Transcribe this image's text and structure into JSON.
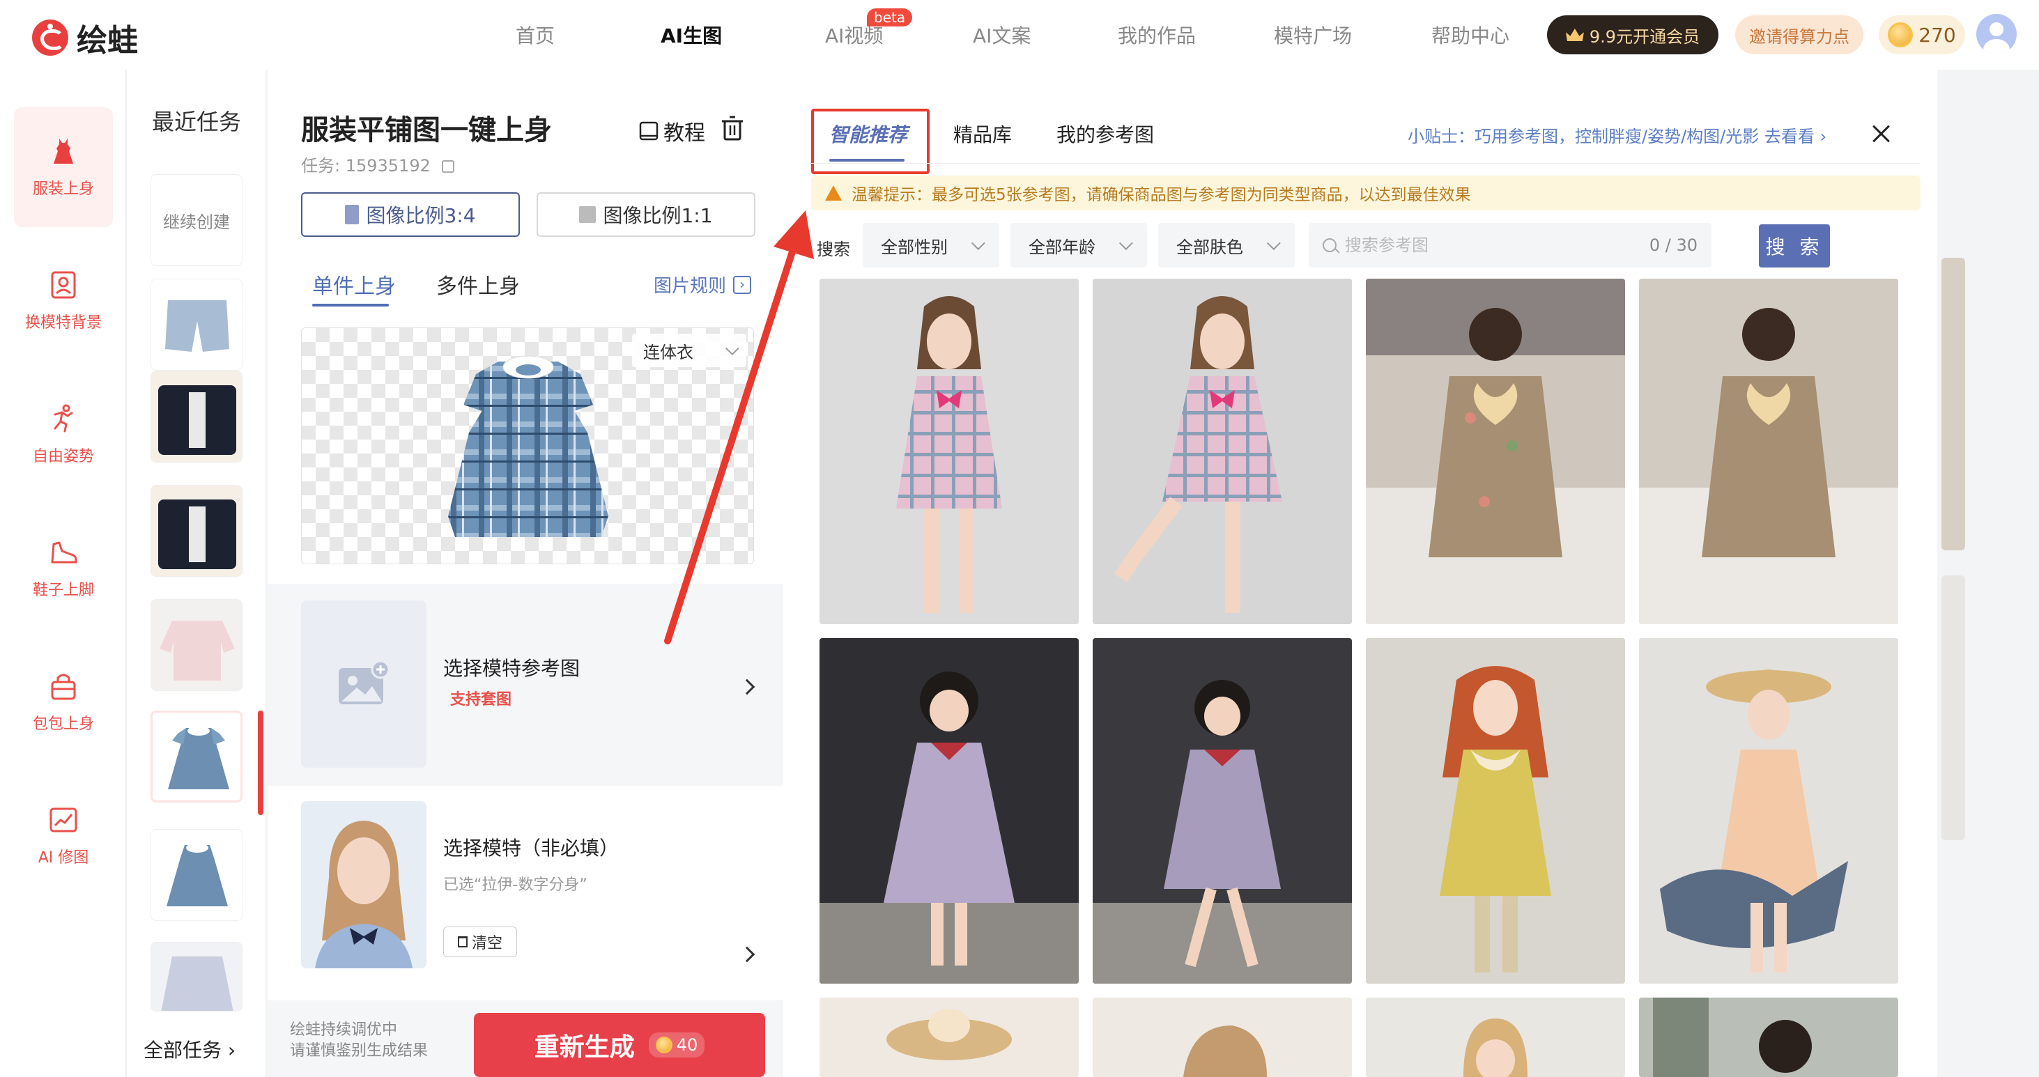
{
  "app": {
    "logo_text": "绘蛙"
  },
  "nav": {
    "items": [
      {
        "label": "首页",
        "active": false
      },
      {
        "label": "AI生图",
        "active": true
      },
      {
        "label": "AI视频",
        "active": false,
        "badge": "beta"
      },
      {
        "label": "AI文案",
        "active": false
      },
      {
        "label": "我的作品",
        "active": false
      },
      {
        "label": "模特广场",
        "active": false
      },
      {
        "label": "帮助中心",
        "active": false
      }
    ],
    "vip_label": "9.9元开通会员",
    "invite_label": "邀请得算力点",
    "coins": "270"
  },
  "sidebar": {
    "items": [
      {
        "label": "服装上身",
        "icon": "dress-icon",
        "active": true
      },
      {
        "label": "换模特背景",
        "icon": "portrait-frame-icon",
        "active": false
      },
      {
        "label": "自由姿势",
        "icon": "running-figure-icon",
        "active": false
      },
      {
        "label": "鞋子上脚",
        "icon": "shoe-icon",
        "active": false
      },
      {
        "label": "包包上身",
        "icon": "bag-icon",
        "active": false
      },
      {
        "label": "AI 修图",
        "icon": "photo-edit-icon",
        "active": false
      }
    ]
  },
  "recent": {
    "title": "最近任务",
    "continue_label": "继续创建",
    "all_tasks_label": "全部任务"
  },
  "work": {
    "title": "服装平铺图一键上身",
    "task_id": "任务: 15935192",
    "tutorial_label": "教程",
    "ratio_options": [
      {
        "label": "图像比例3:4",
        "active": true
      },
      {
        "label": "图像比例1:1",
        "active": false
      }
    ],
    "modes": [
      {
        "label": "单件上身",
        "active": true
      },
      {
        "label": "多件上身",
        "active": false
      }
    ],
    "image_rules_label": "图片规则",
    "category_select": "连体衣",
    "ref_section": {
      "title": "选择模特参考图",
      "subtitle": "支持套图"
    },
    "model_section": {
      "title": "选择模特（非必填）",
      "subtitle": "已选“拉伊-数字分身”",
      "clear_label": "清空"
    },
    "bottom_note_1": "绘蛙持续调优中",
    "bottom_note_2": "请谨慎鉴别生成结果",
    "regen_label": "重新生成",
    "regen_cost": "40"
  },
  "refpanel": {
    "tabs": [
      {
        "label": "智能推荐",
        "active": true
      },
      {
        "label": "精品库",
        "active": false
      },
      {
        "label": "我的参考图",
        "active": false
      }
    ],
    "tip": "小贴士：巧用参考图，控制胖瘦/姿势/构图/光影 去看看",
    "warning": "温馨提示：最多可选5张参考图，请确保商品图与参考图为同类型商品，以达到最佳效果",
    "search_label": "搜索",
    "filters": [
      "全部性别",
      "全部年龄",
      "全部肤色"
    ],
    "search_placeholder": "搜索参考图",
    "search_counter": "0 / 30",
    "search_button": "搜 索"
  },
  "colors": {
    "brand_red": "#e8403f",
    "accent_blue": "#5b6fb5",
    "highlight_red": "#e8392e"
  }
}
